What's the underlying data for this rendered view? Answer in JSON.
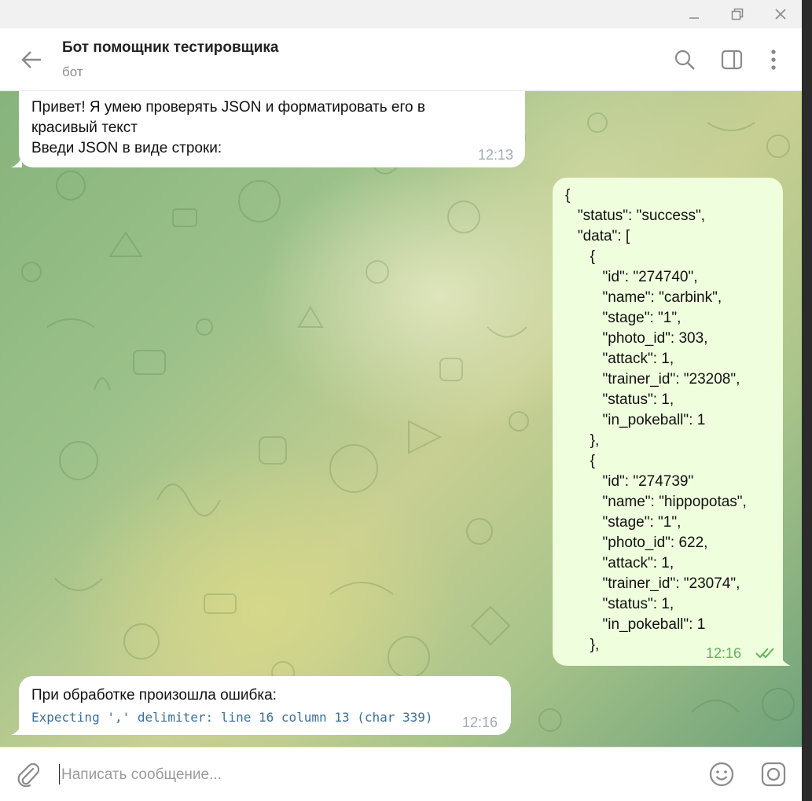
{
  "window": {
    "controls": [
      "minimize-icon",
      "restore-icon",
      "close-icon"
    ]
  },
  "header": {
    "title": "Бот помощник тестировщика",
    "subtitle": "бот"
  },
  "messages": [
    {
      "direction": "incoming",
      "lines": [
        "Привет! Я умею проверять JSON и форматировать его в",
        "красивый текст",
        "Введи JSON в виде строки:"
      ],
      "time": "12:13"
    },
    {
      "direction": "outgoing",
      "lines": [
        "{",
        "   \"status\": \"success\",",
        "   \"data\": [",
        "      {",
        "         \"id\": \"274740\",",
        "         \"name\": \"carbink\",",
        "         \"stage\": \"1\",",
        "         \"photo_id\": 303,",
        "         \"attack\": 1,",
        "         \"trainer_id\": \"23208\",",
        "         \"status\": 1,",
        "         \"in_pokeball\": 1",
        "      },",
        "      {",
        "         \"id\": \"274739\"",
        "         \"name\": \"hippopotas\",",
        "         \"stage\": \"1\",",
        "         \"photo_id\": 622,",
        "         \"attack\": 1,",
        "         \"trainer_id\": \"23074\",",
        "         \"status\": 1,",
        "         \"in_pokeball\": 1",
        "      },"
      ],
      "time": "12:16",
      "status_icon": "double-check-icon"
    },
    {
      "direction": "incoming",
      "text": "При обработке произошла ошибка:",
      "code": "Expecting ',' delimiter: line 16 column 13 (char 339)",
      "time": "12:16"
    }
  ],
  "composer": {
    "placeholder": "Написать сообщение..."
  },
  "colors": {
    "outgoing_bubble": "#effedd",
    "incoming_bubble": "#ffffff",
    "outgoing_time": "#5fb55a",
    "accent": "#3a6f9c"
  }
}
